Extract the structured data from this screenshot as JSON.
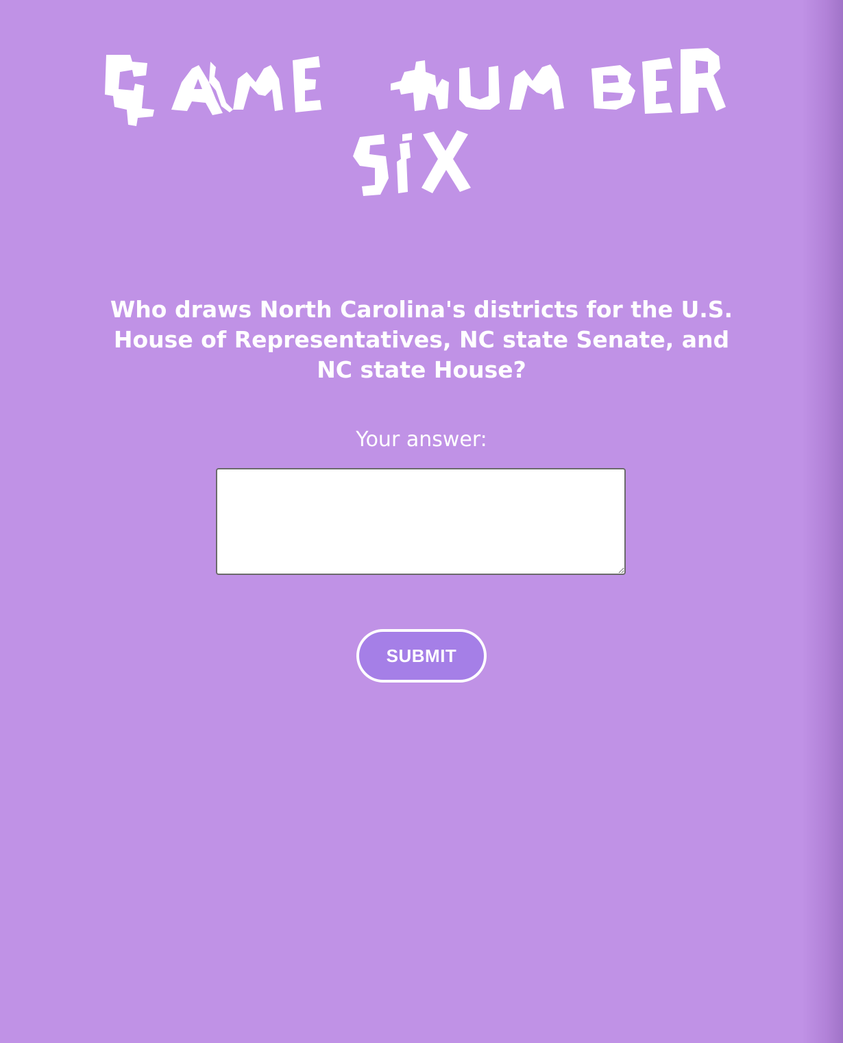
{
  "title": {
    "text": "GAME NUMBER SIX",
    "line1": "GAME NUMBER",
    "line2": "SIX",
    "style": "gerrymandered district shapes"
  },
  "question": {
    "text": "Who draws North Carolina's districts for the U.S. House of Representatives, NC state Senate, and NC state House?"
  },
  "answer": {
    "label": "Your answer:",
    "value": "",
    "placeholder": ""
  },
  "submit": {
    "label": "SUBMIT"
  },
  "colors": {
    "background": "#c092e6",
    "button_fill": "#a57fe7",
    "text": "#ffffff"
  }
}
